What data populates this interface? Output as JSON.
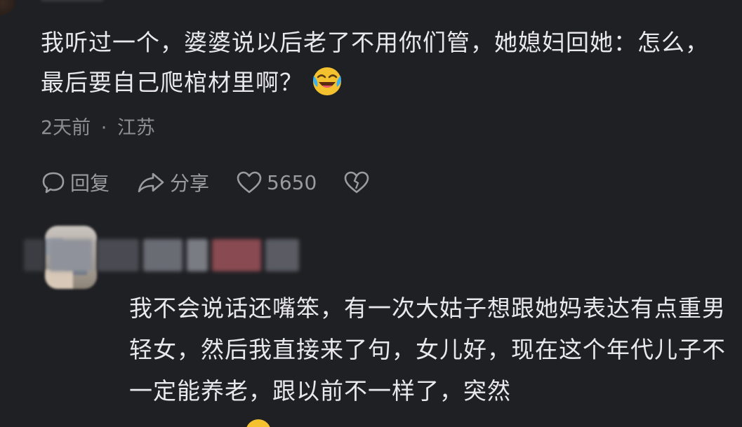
{
  "comment": {
    "text": "我听过一个，婆婆说以后老了不用你们管，她媳妇回她：怎么，最后要自己爬棺材里啊？",
    "emoji": "laughing-crying-emoji",
    "time": "2天前",
    "separator": "·",
    "location": "江苏",
    "actions": {
      "reply_label": "回复",
      "share_label": "分享",
      "like_count": "5650"
    }
  },
  "reply": {
    "text": "我不会说话还嘴笨，有一次大姑子想跟她妈表达有点重男轻女，然后我直接来了句，女儿好，现在这个年代儿子不一定能养老，跟以前不一样了，突然"
  },
  "colors": {
    "background": "#1f2024",
    "text": "#e9e9eb",
    "muted": "#8d8e93",
    "emoji": "#f4c22e"
  }
}
